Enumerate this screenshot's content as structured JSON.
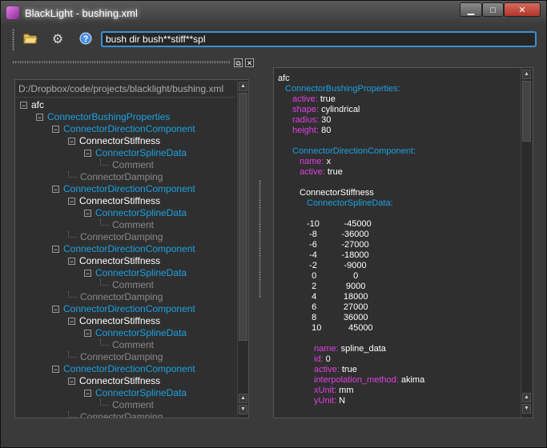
{
  "window": {
    "title": "BlackLight - bushing.xml",
    "minimize": "▁",
    "maximize": "□",
    "close": "✕"
  },
  "toolbar": {
    "open_icon": "folder-open-icon",
    "settings_icon": "gear-icon",
    "help_icon": "help-icon",
    "command_value": "bush dir bush**stiff**spl"
  },
  "left_panel": {
    "path": "D:/Dropbox/code/projects/blacklight/bushing.xml",
    "tree": [
      {
        "label": "afc",
        "depth": 0,
        "color": "white",
        "expander": "−"
      },
      {
        "label": "ConnectorBushingProperties",
        "depth": 1,
        "color": "blue",
        "expander": "−"
      },
      {
        "label": "ConnectorDirectionComponent",
        "depth": 2,
        "color": "blue",
        "expander": "−"
      },
      {
        "label": "ConnectorStiffness",
        "depth": 3,
        "color": "white",
        "expander": "−"
      },
      {
        "label": "ConnectorSplineData",
        "depth": 4,
        "color": "blue",
        "expander": "−"
      },
      {
        "label": "Comment",
        "depth": 5,
        "color": "gray",
        "expander": ""
      },
      {
        "label": "ConnectorDamping",
        "depth": 3,
        "color": "gray",
        "expander": ""
      },
      {
        "label": "ConnectorDirectionComponent",
        "depth": 2,
        "color": "blue",
        "expander": "−"
      },
      {
        "label": "ConnectorStiffness",
        "depth": 3,
        "color": "white",
        "expander": "−"
      },
      {
        "label": "ConnectorSplineData",
        "depth": 4,
        "color": "blue",
        "expander": "−"
      },
      {
        "label": "Comment",
        "depth": 5,
        "color": "gray",
        "expander": ""
      },
      {
        "label": "ConnectorDamping",
        "depth": 3,
        "color": "gray",
        "expander": ""
      },
      {
        "label": "ConnectorDirectionComponent",
        "depth": 2,
        "color": "blue",
        "expander": "−"
      },
      {
        "label": "ConnectorStiffness",
        "depth": 3,
        "color": "white",
        "expander": "−"
      },
      {
        "label": "ConnectorSplineData",
        "depth": 4,
        "color": "blue",
        "expander": "−"
      },
      {
        "label": "Comment",
        "depth": 5,
        "color": "gray",
        "expander": ""
      },
      {
        "label": "ConnectorDamping",
        "depth": 3,
        "color": "gray",
        "expander": ""
      },
      {
        "label": "ConnectorDirectionComponent",
        "depth": 2,
        "color": "blue",
        "expander": "−"
      },
      {
        "label": "ConnectorStiffness",
        "depth": 3,
        "color": "white",
        "expander": "−"
      },
      {
        "label": "ConnectorSplineData",
        "depth": 4,
        "color": "blue",
        "expander": "−"
      },
      {
        "label": "Comment",
        "depth": 5,
        "color": "gray",
        "expander": ""
      },
      {
        "label": "ConnectorDamping",
        "depth": 3,
        "color": "gray",
        "expander": ""
      },
      {
        "label": "ConnectorDirectionComponent",
        "depth": 2,
        "color": "blue",
        "expander": "−"
      },
      {
        "label": "ConnectorStiffness",
        "depth": 3,
        "color": "white",
        "expander": "−"
      },
      {
        "label": "ConnectorSplineData",
        "depth": 4,
        "color": "blue",
        "expander": "−"
      },
      {
        "label": "Comment",
        "depth": 5,
        "color": "gray",
        "expander": ""
      },
      {
        "label": "ConnectorDamping",
        "depth": 3,
        "color": "gray",
        "expander": ""
      }
    ]
  },
  "right_panel": {
    "lines": [
      {
        "indent": 0,
        "parts": [
          {
            "t": "afc",
            "c": "white"
          }
        ]
      },
      {
        "indent": 1,
        "parts": [
          {
            "t": "ConnectorBushingProperties:",
            "c": "blue"
          }
        ]
      },
      {
        "indent": 2,
        "parts": [
          {
            "t": "active:",
            "c": "key"
          },
          {
            "t": " true",
            "c": "white"
          }
        ]
      },
      {
        "indent": 2,
        "parts": [
          {
            "t": "shape:",
            "c": "key"
          },
          {
            "t": " cylindrical",
            "c": "white"
          }
        ]
      },
      {
        "indent": 2,
        "parts": [
          {
            "t": "radius:",
            "c": "key"
          },
          {
            "t": " 30",
            "c": "white"
          }
        ]
      },
      {
        "indent": 2,
        "parts": [
          {
            "t": "height:",
            "c": "key"
          },
          {
            "t": " 80",
            "c": "white"
          }
        ]
      },
      {
        "indent": 0,
        "parts": []
      },
      {
        "indent": 2,
        "parts": [
          {
            "t": "ConnectorDirectionComponent:",
            "c": "blue"
          }
        ]
      },
      {
        "indent": 3,
        "parts": [
          {
            "t": "name:",
            "c": "key"
          },
          {
            "t": " x",
            "c": "white"
          }
        ]
      },
      {
        "indent": 3,
        "parts": [
          {
            "t": "active:",
            "c": "key"
          },
          {
            "t": " true",
            "c": "white"
          }
        ]
      },
      {
        "indent": 0,
        "parts": []
      },
      {
        "indent": 3,
        "parts": [
          {
            "t": "ConnectorStiffness",
            "c": "white"
          }
        ]
      },
      {
        "indent": 4,
        "parts": [
          {
            "t": "ConnectorSplineData:",
            "c": "blue"
          }
        ]
      },
      {
        "indent": 0,
        "parts": []
      },
      {
        "indent": 4,
        "parts": [
          {
            "t": "-10          -45000",
            "c": "white"
          }
        ]
      },
      {
        "indent": 4,
        "parts": [
          {
            "t": " -8          -36000",
            "c": "white"
          }
        ]
      },
      {
        "indent": 4,
        "parts": [
          {
            "t": " -6          -27000",
            "c": "white"
          }
        ]
      },
      {
        "indent": 4,
        "parts": [
          {
            "t": " -4          -18000",
            "c": "white"
          }
        ]
      },
      {
        "indent": 4,
        "parts": [
          {
            "t": " -2           -9000",
            "c": "white"
          }
        ]
      },
      {
        "indent": 4,
        "parts": [
          {
            "t": "  0               0",
            "c": "white"
          }
        ]
      },
      {
        "indent": 4,
        "parts": [
          {
            "t": "  2            9000",
            "c": "white"
          }
        ]
      },
      {
        "indent": 4,
        "parts": [
          {
            "t": "  4           18000",
            "c": "white"
          }
        ]
      },
      {
        "indent": 4,
        "parts": [
          {
            "t": "  6           27000",
            "c": "white"
          }
        ]
      },
      {
        "indent": 4,
        "parts": [
          {
            "t": "  8           36000",
            "c": "white"
          }
        ]
      },
      {
        "indent": 4,
        "parts": [
          {
            "t": "  10           45000",
            "c": "white"
          }
        ]
      },
      {
        "indent": 0,
        "parts": []
      },
      {
        "indent": 5,
        "parts": [
          {
            "t": "name:",
            "c": "key"
          },
          {
            "t": " spline_data",
            "c": "white"
          }
        ]
      },
      {
        "indent": 5,
        "parts": [
          {
            "t": "id:",
            "c": "key"
          },
          {
            "t": " 0",
            "c": "white"
          }
        ]
      },
      {
        "indent": 5,
        "parts": [
          {
            "t": "active:",
            "c": "key"
          },
          {
            "t": " true",
            "c": "white"
          }
        ]
      },
      {
        "indent": 5,
        "parts": [
          {
            "t": "interpolation_method:",
            "c": "key"
          },
          {
            "t": " akima",
            "c": "white"
          }
        ]
      },
      {
        "indent": 5,
        "parts": [
          {
            "t": "xUnit:",
            "c": "key"
          },
          {
            "t": " mm",
            "c": "white"
          }
        ]
      },
      {
        "indent": 5,
        "parts": [
          {
            "t": "yUnit:",
            "c": "key"
          },
          {
            "t": " N",
            "c": "white"
          }
        ]
      }
    ]
  },
  "colors": {
    "accent": "#3d8fd1",
    "blue_text": "#1ba1e2",
    "key_text": "#e040e0"
  }
}
